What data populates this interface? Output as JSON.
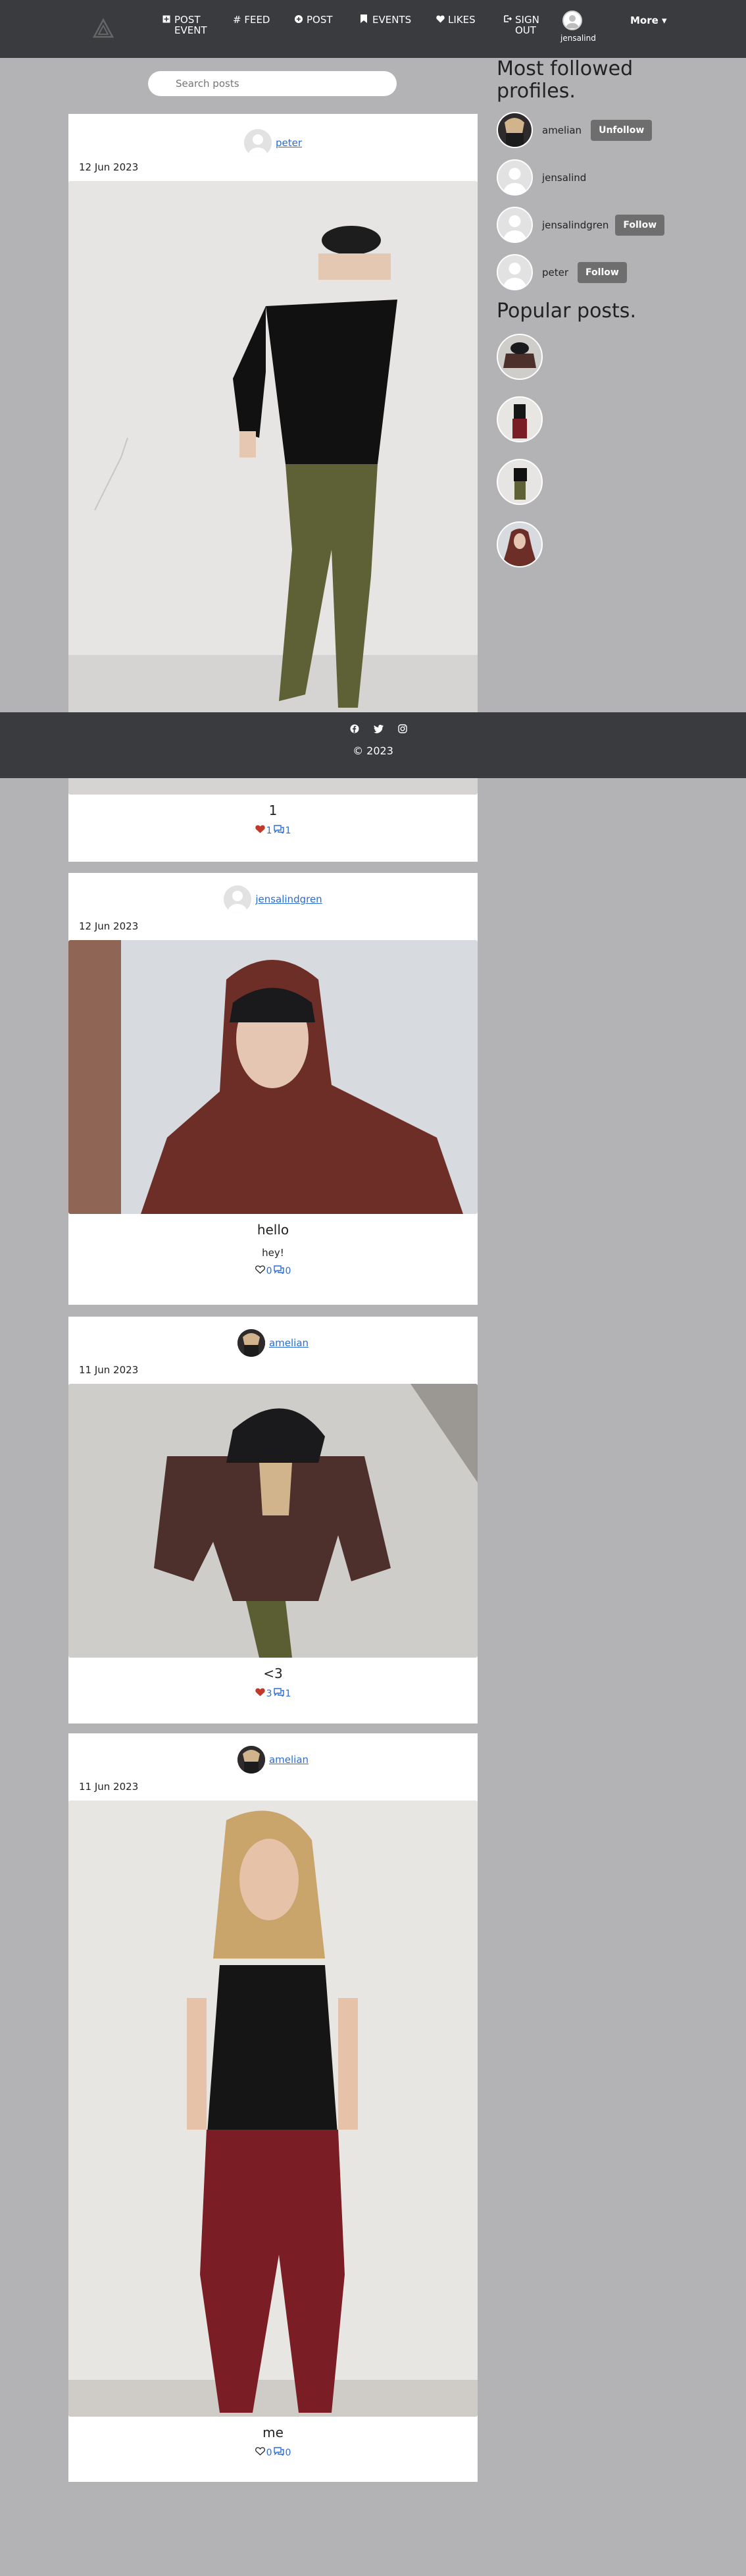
{
  "nav": {
    "items": [
      {
        "label": "POST EVENT",
        "icon": "square-plus-icon"
      },
      {
        "label": "# FEED",
        "icon": "hash-icon"
      },
      {
        "label": "POST",
        "icon": "plus-circle-icon"
      },
      {
        "label": "EVENTS",
        "icon": "bookmark-icon"
      },
      {
        "label": "LIKES",
        "icon": "heart-icon"
      },
      {
        "label": "SIGN OUT",
        "icon": "sign-out-icon"
      }
    ],
    "username": "jensalind",
    "more_label": "More ▾"
  },
  "search": {
    "placeholder": "Search posts"
  },
  "posts": [
    {
      "author": "peter",
      "date": "12 Jun 2023",
      "caption": "1",
      "subcaption": "",
      "likes": "1",
      "comments": "1",
      "liked": true
    },
    {
      "author": "jensalindgren",
      "date": "12 Jun 2023",
      "caption": "hello",
      "subcaption": "hey!",
      "likes": "0",
      "comments": "0",
      "liked": false
    },
    {
      "author": "amelian",
      "date": "11 Jun 2023",
      "caption": "<3",
      "subcaption": "",
      "likes": "3",
      "comments": "1",
      "liked": true
    },
    {
      "author": "amelian",
      "date": "11 Jun 2023",
      "caption": "me",
      "subcaption": "",
      "likes": "0",
      "comments": "0",
      "liked": false
    }
  ],
  "footer": {
    "copyright": "© 2023"
  },
  "sidebar": {
    "followed_title": "Most followed profiles.",
    "profiles": [
      {
        "name": "amelian",
        "button": "Unfollow"
      },
      {
        "name": "jensalind",
        "button": ""
      },
      {
        "name": "jensalindgren",
        "button": "Follow"
      },
      {
        "name": "peter",
        "button": "Follow"
      }
    ],
    "popular_title": "Popular posts."
  },
  "colors": {
    "nav_bg": "#3a3b3f",
    "page_bg": "#b3b3b5",
    "link": "#2a6cd6",
    "heart": "#c0392b"
  }
}
